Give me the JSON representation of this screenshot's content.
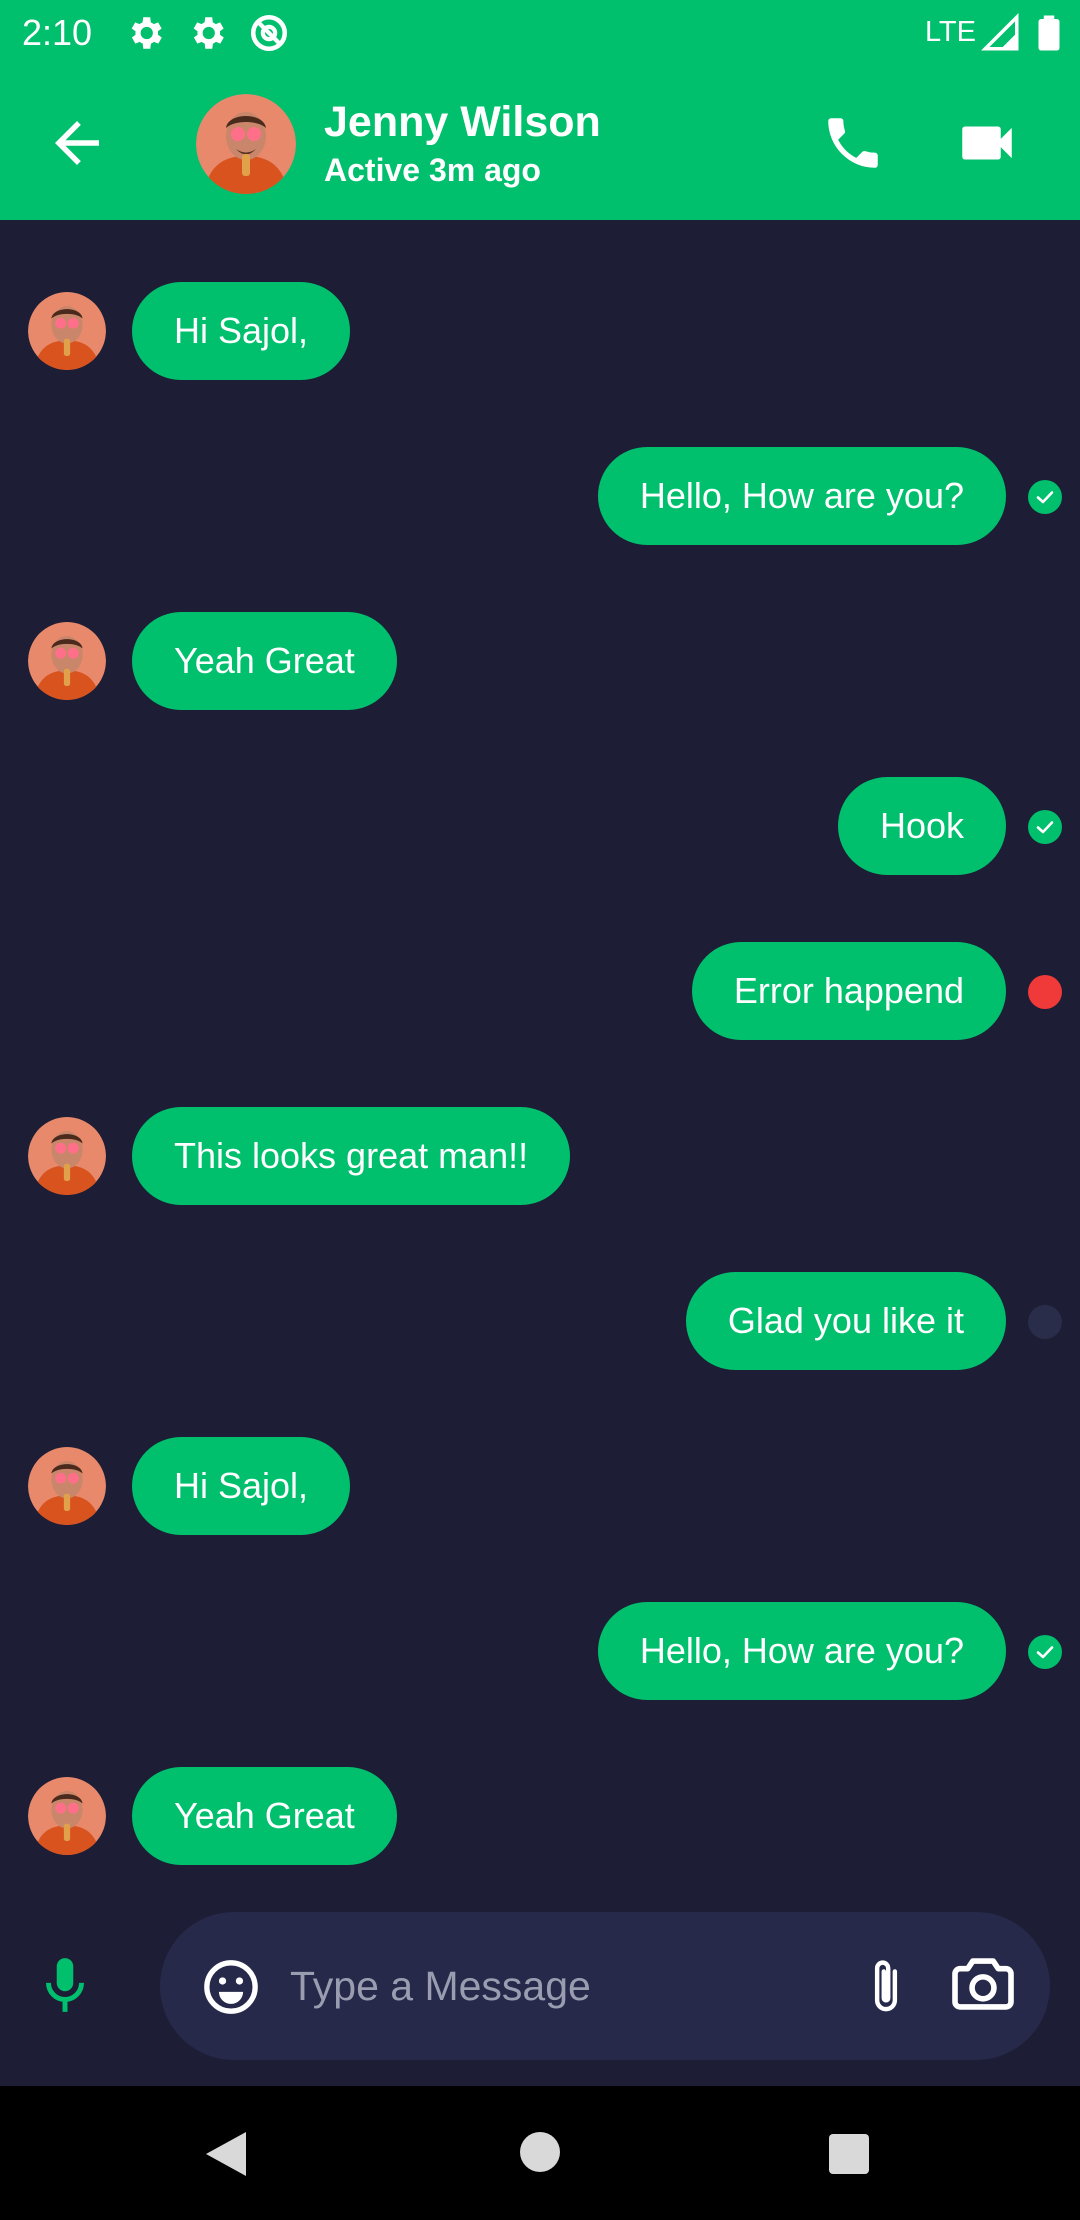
{
  "status_bar": {
    "time": "2:10",
    "network": "LTE",
    "icons": [
      "settings-icon",
      "settings-icon",
      "sync-icon",
      "signal-icon",
      "battery-icon"
    ]
  },
  "header": {
    "contact_name": "Jenny Wilson",
    "contact_status": "Active 3m ago",
    "icons": [
      "back-arrow-icon",
      "avatar",
      "phone-icon",
      "video-camera-icon"
    ]
  },
  "messages": [
    {
      "direction": "incoming",
      "text": "Hi Sajol,"
    },
    {
      "direction": "outgoing",
      "text": "Hello, How are you?",
      "status": "sent"
    },
    {
      "direction": "incoming",
      "text": "Yeah Great"
    },
    {
      "direction": "outgoing",
      "text": "Hook",
      "status": "sent"
    },
    {
      "direction": "outgoing",
      "text": "Error happend",
      "status": "error"
    },
    {
      "direction": "incoming",
      "text": "This looks great man!!"
    },
    {
      "direction": "outgoing",
      "text": "Glad you like it",
      "status": "pending"
    },
    {
      "direction": "incoming",
      "text": "Hi Sajol,"
    },
    {
      "direction": "outgoing",
      "text": "Hello, How are you?",
      "status": "sent"
    },
    {
      "direction": "incoming",
      "text": "Yeah Great"
    }
  ],
  "composer": {
    "placeholder": "Type a Message",
    "value": "",
    "icons": [
      "microphone-icon",
      "emoji-icon",
      "attach-icon",
      "camera-icon"
    ]
  },
  "navigation_bar": {
    "icons": [
      "nav-back-icon",
      "nav-home-icon",
      "nav-recents-icon"
    ]
  },
  "colors": {
    "accent": "#00bf6d",
    "background": "#1d1d35",
    "input_background": "#27294a",
    "error": "#f03a3a",
    "text": "#ffffff"
  }
}
